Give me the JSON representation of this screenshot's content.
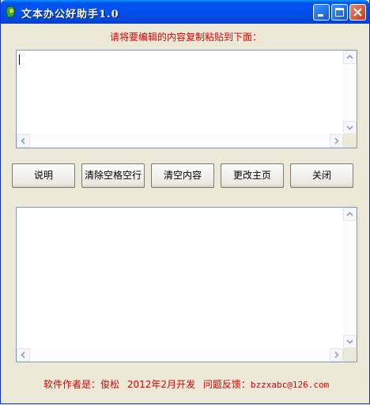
{
  "window": {
    "title": "文本办公好助手1.0"
  },
  "prompt": "请将要编辑的内容复制粘贴到下面：",
  "buttons": {
    "help": "说明",
    "clear_spaces": "清除空格空行",
    "clear_content": "清空内容",
    "change_home": "更改主页",
    "close": "关闭"
  },
  "input_box": {
    "value": ""
  },
  "output_box": {
    "value": ""
  },
  "footer": {
    "author_label": "软件作者是：俊松",
    "date_text": "2012年2月开发",
    "feedback_label": "问题反馈：",
    "email": "bzzxabc@126.com"
  },
  "colors": {
    "label_red": "#e00000",
    "titlebar_blue": "#0050ee",
    "window_bg": "#ece9d8"
  }
}
